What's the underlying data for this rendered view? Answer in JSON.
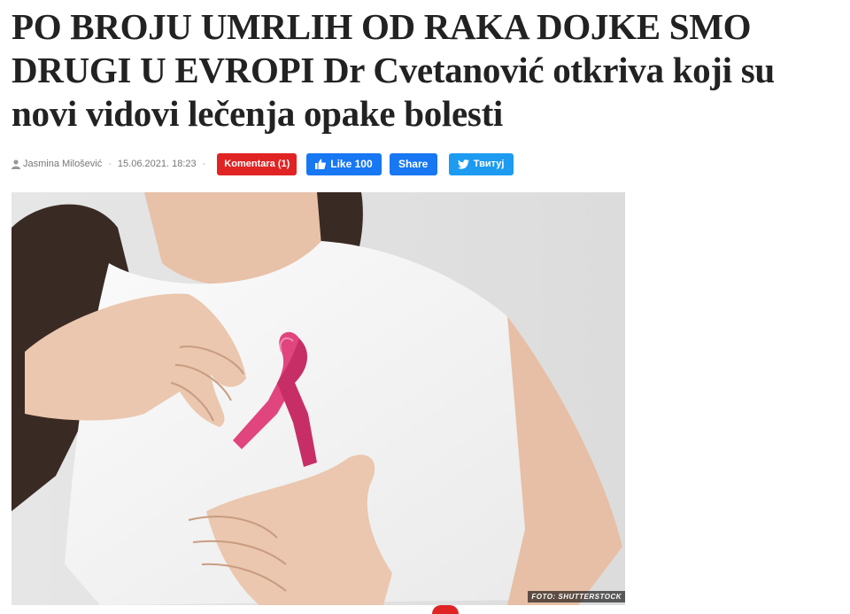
{
  "article": {
    "headline": "PO BROJU UMRLIH OD RAKA DOJKE SMO DRUGI U EVROPI Dr Cvetanović otkriva koji su novi vidovi lečenja opake bolesti",
    "author": "Jasmina Milošević",
    "date": "15.06.2021. 18:23",
    "photo_credit": "FOTO: SHUTTERSTOCK"
  },
  "actions": {
    "comments_label": "Komentara (1)",
    "like_label": "Like 100",
    "share_label": "Share",
    "tweet_label": "Твитуј"
  },
  "icons": {
    "author": "user-icon",
    "like": "thumbs-up-icon",
    "tweet": "twitter-bird-icon"
  },
  "colors": {
    "comments": "#e02424",
    "facebook": "#1877f2",
    "twitter": "#1d9bf0",
    "ribbon": "#e0457e"
  }
}
